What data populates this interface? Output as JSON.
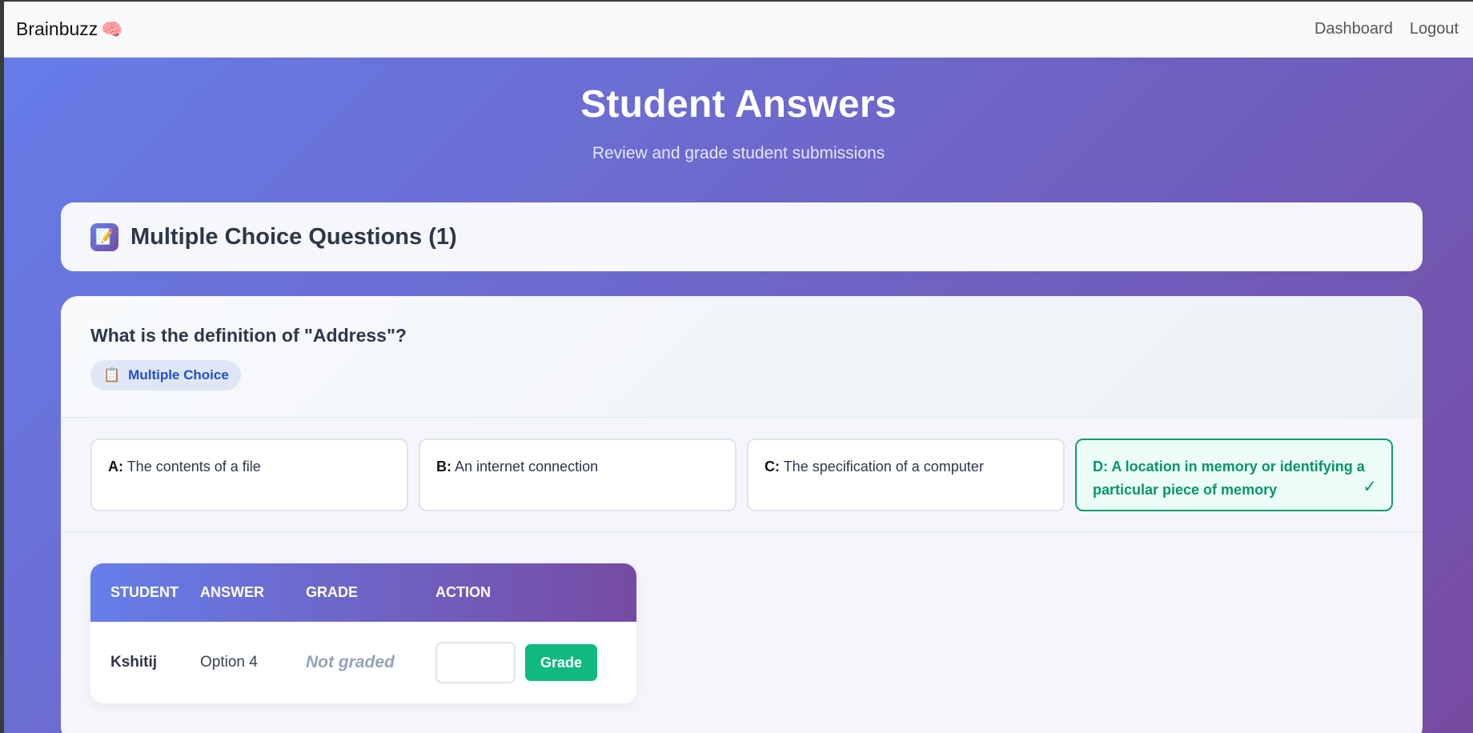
{
  "navbar": {
    "brand": "Brainbuzz",
    "brand_icon": "🧠",
    "links": [
      "Dashboard",
      "Logout"
    ]
  },
  "hero": {
    "title": "Student Answers",
    "subtitle": "Review and grade student submissions"
  },
  "section": {
    "icon": "📝",
    "title": "Multiple Choice Questions (1)"
  },
  "question": {
    "text": "What is the definition of \"Address\"?",
    "type_icon": "📋",
    "type_label": "Multiple Choice",
    "options": [
      {
        "key": "A:",
        "text": "The contents of a file",
        "correct": false
      },
      {
        "key": "B:",
        "text": "An internet connection",
        "correct": false
      },
      {
        "key": "C:",
        "text": "The specification of a computer",
        "correct": false
      },
      {
        "key": "D:",
        "text": "A location in memory or identifying a particular piece of memory",
        "correct": true
      }
    ],
    "correct_mark": "✓"
  },
  "table": {
    "headers": [
      "STUDENT",
      "ANSWER",
      "GRADE",
      "ACTION"
    ],
    "rows": [
      {
        "student": "Kshitij",
        "answer": "Option 4",
        "grade": "Not graded",
        "grade_input_value": "",
        "action_label": "Grade"
      }
    ]
  },
  "colors": {
    "gradient_start": "#667eea",
    "gradient_end": "#764ba2",
    "correct": "#059669",
    "grade_button": "#10b981",
    "badge_text": "#1d4ed8"
  }
}
